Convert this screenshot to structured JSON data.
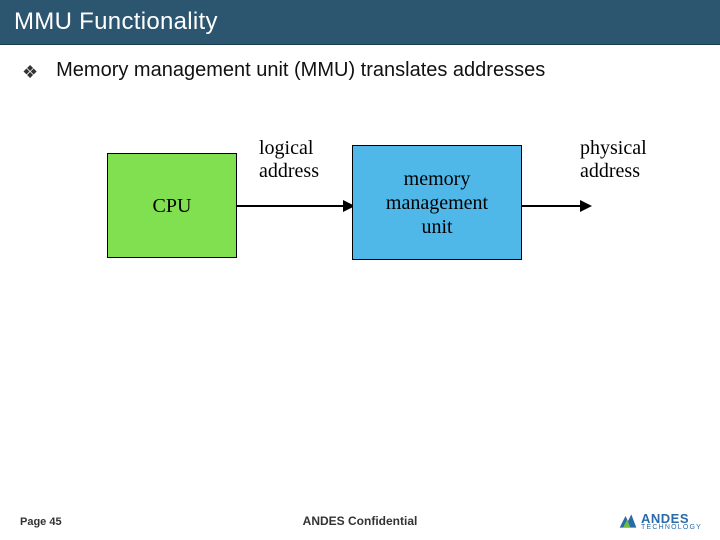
{
  "header": {
    "title": "MMU Functionality"
  },
  "bullets": [
    {
      "glyph": "❖",
      "text": "Memory management unit (MMU) translates addresses"
    }
  ],
  "diagram": {
    "cpu_label": "CPU",
    "mmu_label": "memory\nmanagement\nunit",
    "logical_label": "logical\naddress",
    "physical_label": "physical\naddress"
  },
  "footer": {
    "page": "Page 45",
    "confidential": "ANDES Confidential",
    "logo_text": "ANDES",
    "logo_sub": "TECHNOLOGY"
  },
  "colors": {
    "titlebar_bg": "#2c5570",
    "cpu_fill": "#80e050",
    "mmu_fill": "#4fb8e8",
    "logo_blue": "#2a6aa8",
    "logo_green": "#6fbf3f"
  }
}
